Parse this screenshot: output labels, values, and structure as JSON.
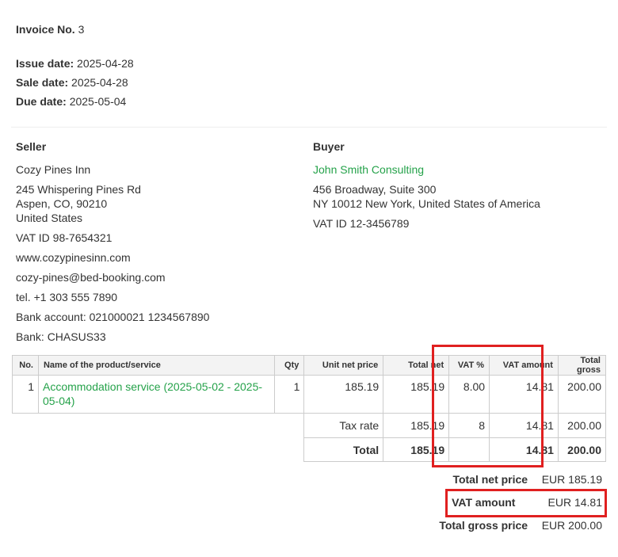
{
  "invoice": {
    "number_label": "Invoice No.",
    "number": "3",
    "issue_label": "Issue date:",
    "issue_date": "2025-04-28",
    "sale_label": "Sale date:",
    "sale_date": "2025-04-28",
    "due_label": "Due date:",
    "due_date": "2025-05-04"
  },
  "seller": {
    "title": "Seller",
    "name": "Cozy Pines Inn",
    "address1": "245 Whispering Pines Rd",
    "address2": "Aspen, CO, 90210",
    "country": "United States",
    "vat_id": "VAT ID 98-7654321",
    "website": "www.cozypinesinn.com",
    "email": "cozy-pines@bed-booking.com",
    "phone": "tel. +1 303 555 7890",
    "bank_account": "Bank account: 021000021 1234567890",
    "bank": "Bank: CHASUS33"
  },
  "buyer": {
    "title": "Buyer",
    "name": "John Smith Consulting",
    "address1": "456 Broadway, Suite 300",
    "address2": "NY 10012 New York, United States of America",
    "vat_id": "VAT ID 12-3456789"
  },
  "table": {
    "headers": [
      "No.",
      "Name of the product/service",
      "Qty",
      "Unit net price",
      "Total net",
      "VAT %",
      "VAT amount",
      "Total gross"
    ],
    "row": {
      "no": "1",
      "name": "Accommodation service (2025-05-02 - 2025-05-04)",
      "qty": "1",
      "unit_net": "185.19",
      "total_net": "185.19",
      "vat_pct": "8.00",
      "vat_amount": "14.81",
      "total_gross": "200.00"
    },
    "tax_row": {
      "label": "Tax rate",
      "total_net": "185.19",
      "vat_pct": "8",
      "vat_amount": "14.81",
      "total_gross": "200.00"
    },
    "total_row": {
      "label": "Total",
      "total_net": "185.19",
      "vat_amount": "14.81",
      "total_gross": "200.00"
    }
  },
  "summary": {
    "net_label": "Total net price",
    "net_value": "EUR 185.19",
    "vat_label": "VAT amount",
    "vat_value": "EUR 14.81",
    "gross_label": "Total gross price",
    "gross_value": "EUR 200.00"
  },
  "colors": {
    "link_green": "#25a24a",
    "highlight_red": "#e02020"
  }
}
